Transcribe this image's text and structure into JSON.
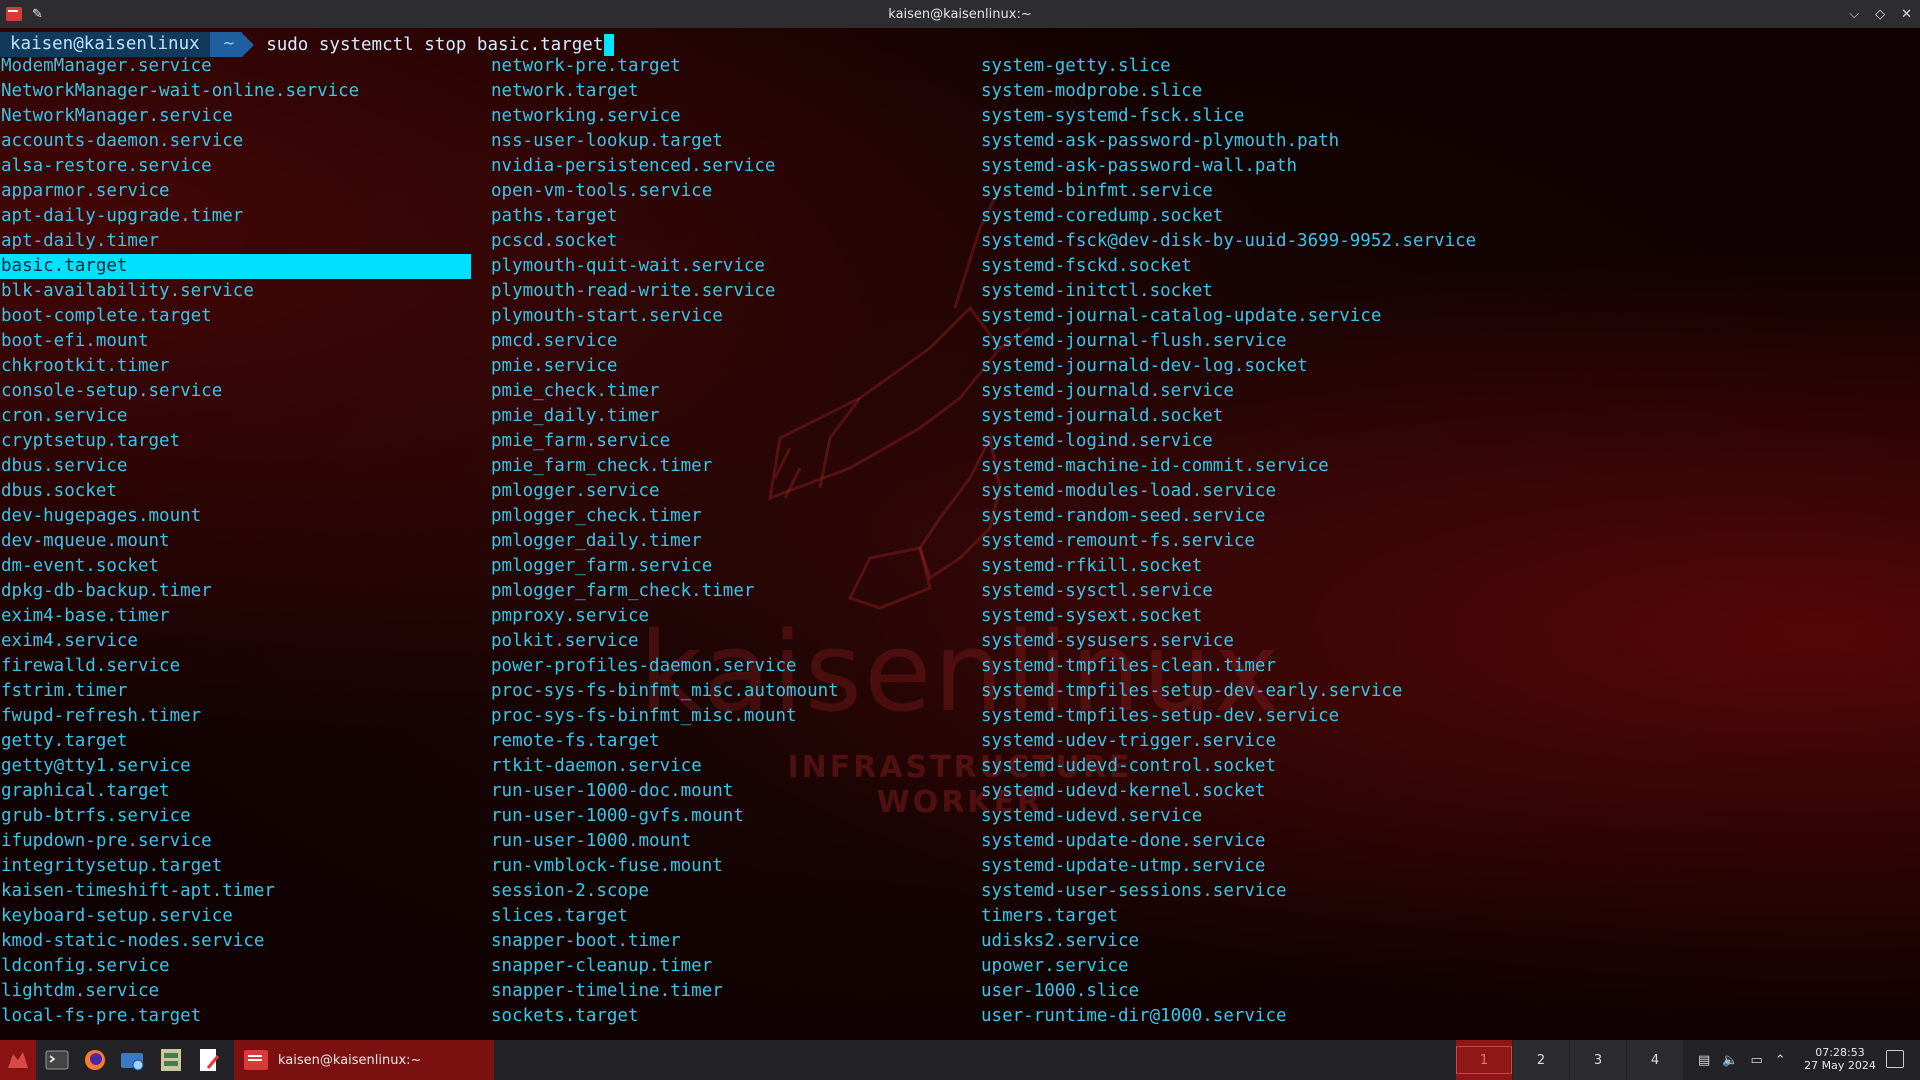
{
  "window": {
    "title": "kaisen@kaisenlinux:~"
  },
  "prompt": {
    "user_host": "kaisen@kaisenlinux",
    "dir": "~",
    "command": "sudo systemctl stop basic.target"
  },
  "watermark": {
    "brand": "kaisenlinux",
    "tagline": "INFRASTRUCTURE WORKER"
  },
  "completions": {
    "col1": [
      "ModemManager.service",
      "NetworkManager-wait-online.service",
      "NetworkManager.service",
      "accounts-daemon.service",
      "alsa-restore.service",
      "apparmor.service",
      "apt-daily-upgrade.timer",
      "apt-daily.timer",
      "basic.target",
      "blk-availability.service",
      "boot-complete.target",
      "boot-efi.mount",
      "chkrootkit.timer",
      "console-setup.service",
      "cron.service",
      "cryptsetup.target",
      "dbus.service",
      "dbus.socket",
      "dev-hugepages.mount",
      "dev-mqueue.mount",
      "dm-event.socket",
      "dpkg-db-backup.timer",
      "exim4-base.timer",
      "exim4.service",
      "firewalld.service",
      "fstrim.timer",
      "fwupd-refresh.timer",
      "getty.target",
      "getty@tty1.service",
      "graphical.target",
      "grub-btrfs.service",
      "ifupdown-pre.service",
      "integritysetup.target",
      "kaisen-timeshift-apt.timer",
      "keyboard-setup.service",
      "kmod-static-nodes.service",
      "ldconfig.service",
      "lightdm.service",
      "local-fs-pre.target"
    ],
    "col2": [
      "network-pre.target",
      "network.target",
      "networking.service",
      "nss-user-lookup.target",
      "nvidia-persistenced.service",
      "open-vm-tools.service",
      "paths.target",
      "pcscd.socket",
      "plymouth-quit-wait.service",
      "plymouth-read-write.service",
      "plymouth-start.service",
      "pmcd.service",
      "pmie.service",
      "pmie_check.timer",
      "pmie_daily.timer",
      "pmie_farm.service",
      "pmie_farm_check.timer",
      "pmlogger.service",
      "pmlogger_check.timer",
      "pmlogger_daily.timer",
      "pmlogger_farm.service",
      "pmlogger_farm_check.timer",
      "pmproxy.service",
      "polkit.service",
      "power-profiles-daemon.service",
      "proc-sys-fs-binfmt_misc.automount",
      "proc-sys-fs-binfmt_misc.mount",
      "remote-fs.target",
      "rtkit-daemon.service",
      "run-user-1000-doc.mount",
      "run-user-1000-gvfs.mount",
      "run-user-1000.mount",
      "run-vmblock-fuse.mount",
      "session-2.scope",
      "slices.target",
      "snapper-boot.timer",
      "snapper-cleanup.timer",
      "snapper-timeline.timer",
      "sockets.target"
    ],
    "col3": [
      "system-getty.slice",
      "system-modprobe.slice",
      "system-systemd-fsck.slice",
      "systemd-ask-password-plymouth.path",
      "systemd-ask-password-wall.path",
      "systemd-binfmt.service",
      "systemd-coredump.socket",
      "systemd-fsck@dev-disk-by-uuid-3699-9952.service",
      "systemd-fsckd.socket",
      "systemd-initctl.socket",
      "systemd-journal-catalog-update.service",
      "systemd-journal-flush.service",
      "systemd-journald-dev-log.socket",
      "systemd-journald.service",
      "systemd-journald.socket",
      "systemd-logind.service",
      "systemd-machine-id-commit.service",
      "systemd-modules-load.service",
      "systemd-random-seed.service",
      "systemd-remount-fs.service",
      "systemd-rfkill.socket",
      "systemd-sysctl.service",
      "systemd-sysext.socket",
      "systemd-sysusers.service",
      "systemd-tmpfiles-clean.timer",
      "systemd-tmpfiles-setup-dev-early.service",
      "systemd-tmpfiles-setup-dev.service",
      "systemd-udev-trigger.service",
      "systemd-udevd-control.socket",
      "systemd-udevd-kernel.socket",
      "systemd-udevd.service",
      "systemd-update-done.service",
      "systemd-update-utmp.service",
      "systemd-user-sessions.service",
      "timers.target",
      "udisks2.service",
      "upower.service",
      "user-1000.slice",
      "user-runtime-dir@1000.service"
    ],
    "selected": "basic.target"
  },
  "taskbar": {
    "task_label": "kaisen@kaisenlinux:~",
    "workspaces": [
      "1",
      "2",
      "3",
      "4"
    ],
    "active_workspace": "1",
    "time": "07:28:53",
    "date": "27 May 2024"
  },
  "colors": {
    "accent": "#00e1ff",
    "text": "#39c5e9",
    "brand_red": "#8e1818"
  }
}
